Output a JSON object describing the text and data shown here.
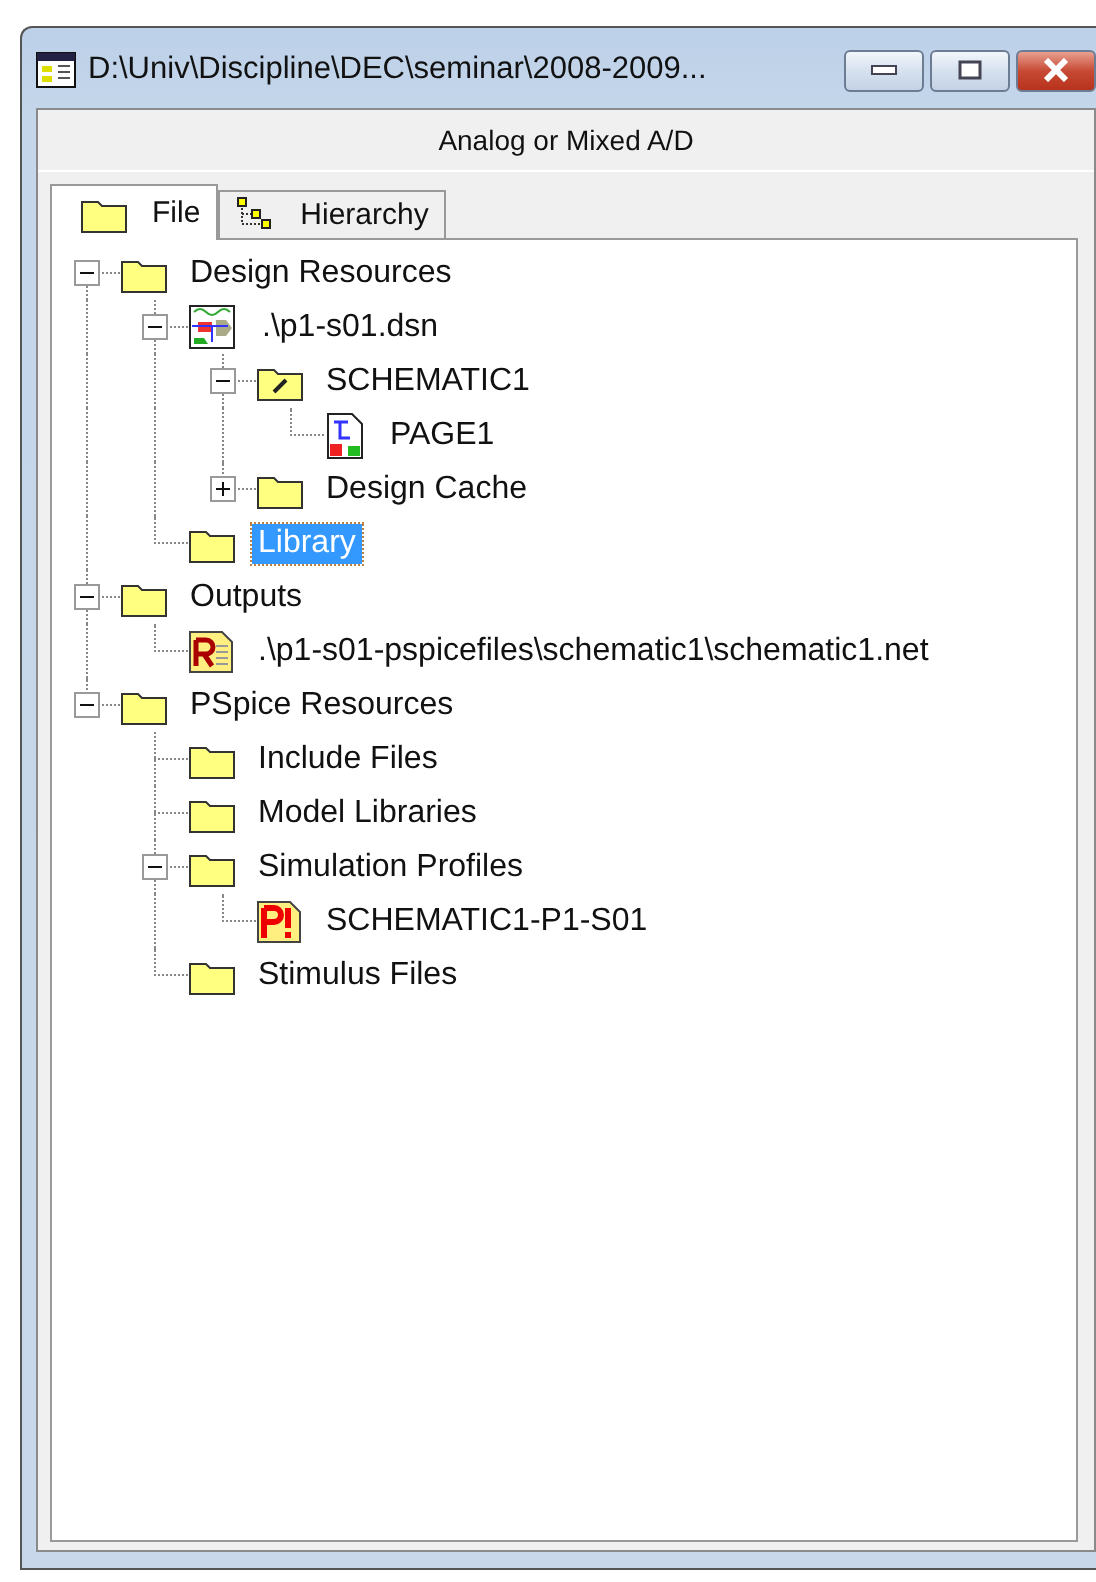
{
  "window": {
    "title": "D:\\Univ\\Discipline\\DEC\\seminar\\2008-2009..."
  },
  "header": {
    "label": "Analog or Mixed A/D"
  },
  "tabs": [
    {
      "label": "File",
      "selected": true
    },
    {
      "label": "Hierarchy",
      "selected": false
    }
  ],
  "tree": [
    {
      "label": "Design Resources",
      "kind": "folder",
      "expanded": true,
      "selected": false,
      "children": [
        {
          "label": ".\\p1-s01.dsn",
          "kind": "design",
          "expanded": true,
          "selected": false,
          "children": [
            {
              "label": "SCHEMATIC1",
              "kind": "schematic",
              "expanded": true,
              "selected": false,
              "children": [
                {
                  "label": "PAGE1",
                  "kind": "page",
                  "selected": false
                }
              ]
            },
            {
              "label": "Design Cache",
              "kind": "folder",
              "expanded": false,
              "selected": false
            }
          ]
        },
        {
          "label": "Library",
          "kind": "folder",
          "selected": true
        }
      ]
    },
    {
      "label": "Outputs",
      "kind": "folder",
      "expanded": true,
      "selected": false,
      "children": [
        {
          "label": ".\\p1-s01-pspicefiles\\schematic1\\schematic1.net",
          "kind": "netlist",
          "selected": false
        }
      ]
    },
    {
      "label": "PSpice Resources",
      "kind": "folder",
      "expanded": true,
      "selected": false,
      "children": [
        {
          "label": "Include Files",
          "kind": "folder",
          "selected": false
        },
        {
          "label": "Model Libraries",
          "kind": "folder",
          "selected": false
        },
        {
          "label": "Simulation Profiles",
          "kind": "folder",
          "expanded": true,
          "selected": false,
          "children": [
            {
              "label": "SCHEMATIC1-P1-S01",
              "kind": "profile",
              "selected": false
            }
          ]
        },
        {
          "label": "Stimulus Files",
          "kind": "folder",
          "selected": false
        }
      ]
    }
  ]
}
